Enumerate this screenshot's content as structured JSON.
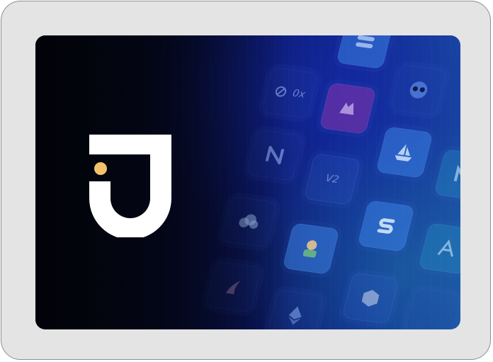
{
  "device": {
    "frame_color": "#e4e4e4",
    "border_color": "#8e8e8e"
  },
  "screen": {
    "background_colors": [
      "#02030a",
      "#0a1660",
      "#1a4ca0"
    ],
    "logo": {
      "icon": "j-logo-icon",
      "letter_color": "#ffffff",
      "dot_color": "#f3c16a"
    },
    "tiles": [
      {
        "icon": "stack-icon"
      },
      {
        "icon": "zerox-icon",
        "label": "0x"
      },
      {
        "icon": "wolf-icon"
      },
      {
        "icon": "owl-icon"
      },
      {
        "icon": "near-icon"
      },
      {
        "icon": "boat-icon"
      },
      {
        "label": "V2"
      },
      {
        "icon": "letter-n-icon"
      },
      {
        "icon": "cloud-face-icon"
      },
      {
        "icon": "s-logo-icon"
      },
      {
        "icon": "character-icon"
      },
      {
        "icon": "arrow-a-icon"
      },
      {
        "icon": "phoenix-icon"
      },
      {
        "icon": "ethereum-icon"
      },
      {
        "icon": "cube-icon"
      }
    ]
  }
}
